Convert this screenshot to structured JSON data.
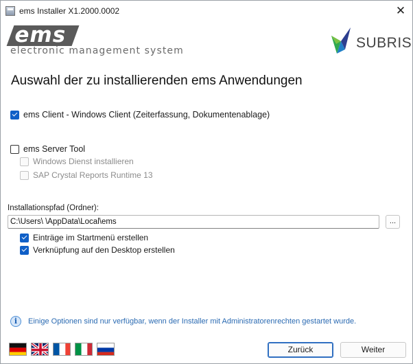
{
  "window": {
    "title": "ems Installer X1.2000.0002",
    "close_glyph": "✕"
  },
  "logos": {
    "ems_mark": "ems",
    "ems_subtitle": "electronic management system",
    "subris_text": "SUBRIS"
  },
  "heading": "Auswahl der zu installierenden ems Anwendungen",
  "options": {
    "client": {
      "label": "ems Client - Windows Client (Zeiterfassung, Dokumentenablage)",
      "checked": true
    },
    "server": {
      "label": "ems Server Tool",
      "checked": false
    },
    "windows_service": {
      "label": "Windows Dienst installieren",
      "checked": false,
      "disabled": true
    },
    "crystal_reports": {
      "label": "SAP Crystal Reports Runtime 13",
      "checked": false,
      "disabled": true
    }
  },
  "path": {
    "label": "Installationspfad (Ordner):",
    "value": "C:\\Users\\          \\AppData\\Local\\ems",
    "browse_label": "..."
  },
  "shortcuts": {
    "startmenu": {
      "label": "Einträge im Startmenü erstellen",
      "checked": true
    },
    "desktop": {
      "label": "Verknüpfung auf den Desktop erstellen",
      "checked": true
    }
  },
  "info": {
    "icon": "info-icon",
    "glyph": "i",
    "text": "Einige Optionen sind nur verfügbar, wenn der Installer mit Administratorenrechten gestartet wurde."
  },
  "languages": [
    "de",
    "en",
    "fr",
    "it",
    "ru"
  ],
  "buttons": {
    "back": "Zurück",
    "next": "Weiter"
  },
  "colors": {
    "accent": "#0f5fc7",
    "info_text": "#2a6ab2"
  }
}
